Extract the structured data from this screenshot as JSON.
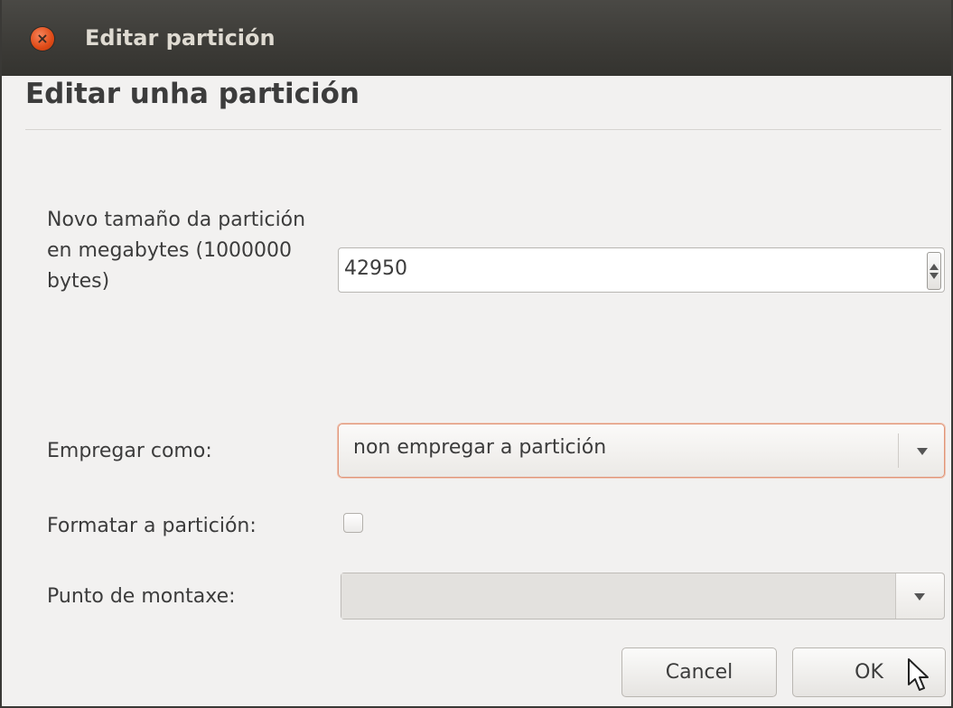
{
  "window": {
    "title": "Editar partición",
    "close_icon": "close-icon"
  },
  "dialog": {
    "heading": "Editar unha partición",
    "size": {
      "label": "Novo tamaño da partición en megabytes (1000000 bytes)",
      "value": "42950"
    },
    "use_as": {
      "label": "Empregar como:",
      "selected": "non empregar a partición"
    },
    "format": {
      "label": "Formatar a partición:",
      "checked": false
    },
    "mount_point": {
      "label": "Punto de montaxe:",
      "value": ""
    },
    "buttons": {
      "cancel": "Cancel",
      "ok": "OK"
    }
  },
  "colors": {
    "titlebar": "#3c3b37",
    "close": "#df4a16",
    "focus_border": "#e09578",
    "background": "#f2f1f0"
  }
}
